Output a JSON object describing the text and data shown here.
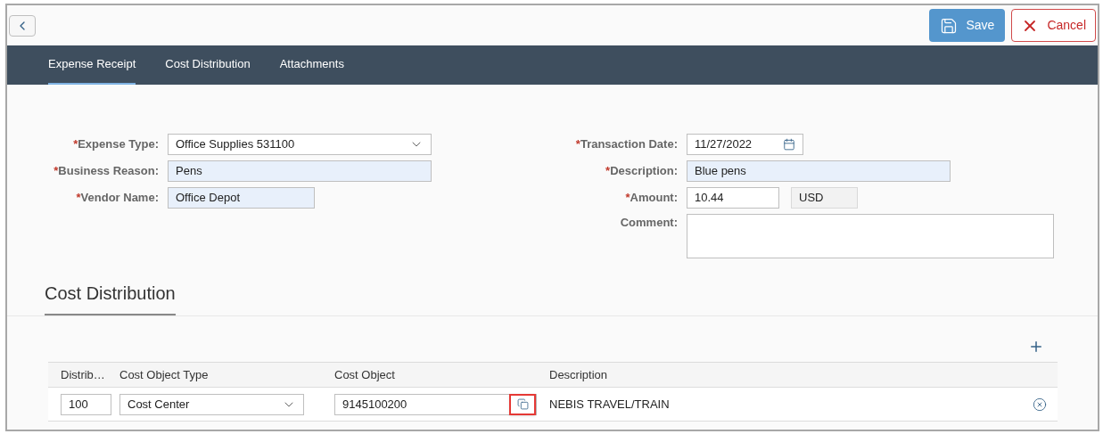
{
  "toolbar": {
    "buttons": [
      {
        "label": "Save",
        "kind": "primary"
      },
      {
        "label": "Cancel",
        "kind": "reject"
      }
    ]
  },
  "tabs": [
    {
      "label": "Expense Receipt",
      "selected": true
    },
    {
      "label": "Cost Distribution",
      "selected": false
    },
    {
      "label": "Attachments",
      "selected": false
    }
  ],
  "form": {
    "required_symbol": "*",
    "left": [
      {
        "label": "Expense Type:",
        "required": true,
        "kind": "select",
        "value": "Office Supplies 531100",
        "highlighted": false
      },
      {
        "label": "Business Reason:",
        "required": true,
        "kind": "input",
        "value": "Pens",
        "highlighted": true
      },
      {
        "label": "Vendor Name:",
        "required": true,
        "kind": "input",
        "value": "Office Depot",
        "highlighted": true
      }
    ],
    "right": [
      {
        "label": "Transaction Date:",
        "required": true,
        "kind": "date",
        "value": "11/27/2022",
        "highlighted": false
      },
      {
        "label": "Description:",
        "required": true,
        "kind": "input",
        "value": "Blue pens",
        "highlighted": true
      },
      {
        "label": "Amount:",
        "required": true,
        "kind": "amount",
        "value": "10.44",
        "currency": "USD",
        "highlighted": false
      },
      {
        "label": "Comment:",
        "required": false,
        "kind": "textarea",
        "highlighted": false
      }
    ]
  },
  "section": {
    "title": "Cost Distribution"
  },
  "table": {
    "columns": [
      "Distrib…",
      "Cost Object Type",
      "Cost Object",
      "Description"
    ],
    "rows": [
      {
        "distribution": "100",
        "cost_object_type": "Cost Center",
        "cost_object": "9145100200",
        "description": "NEBIS TRAVEL/TRAIN",
        "value_help_marked": true
      }
    ]
  }
}
